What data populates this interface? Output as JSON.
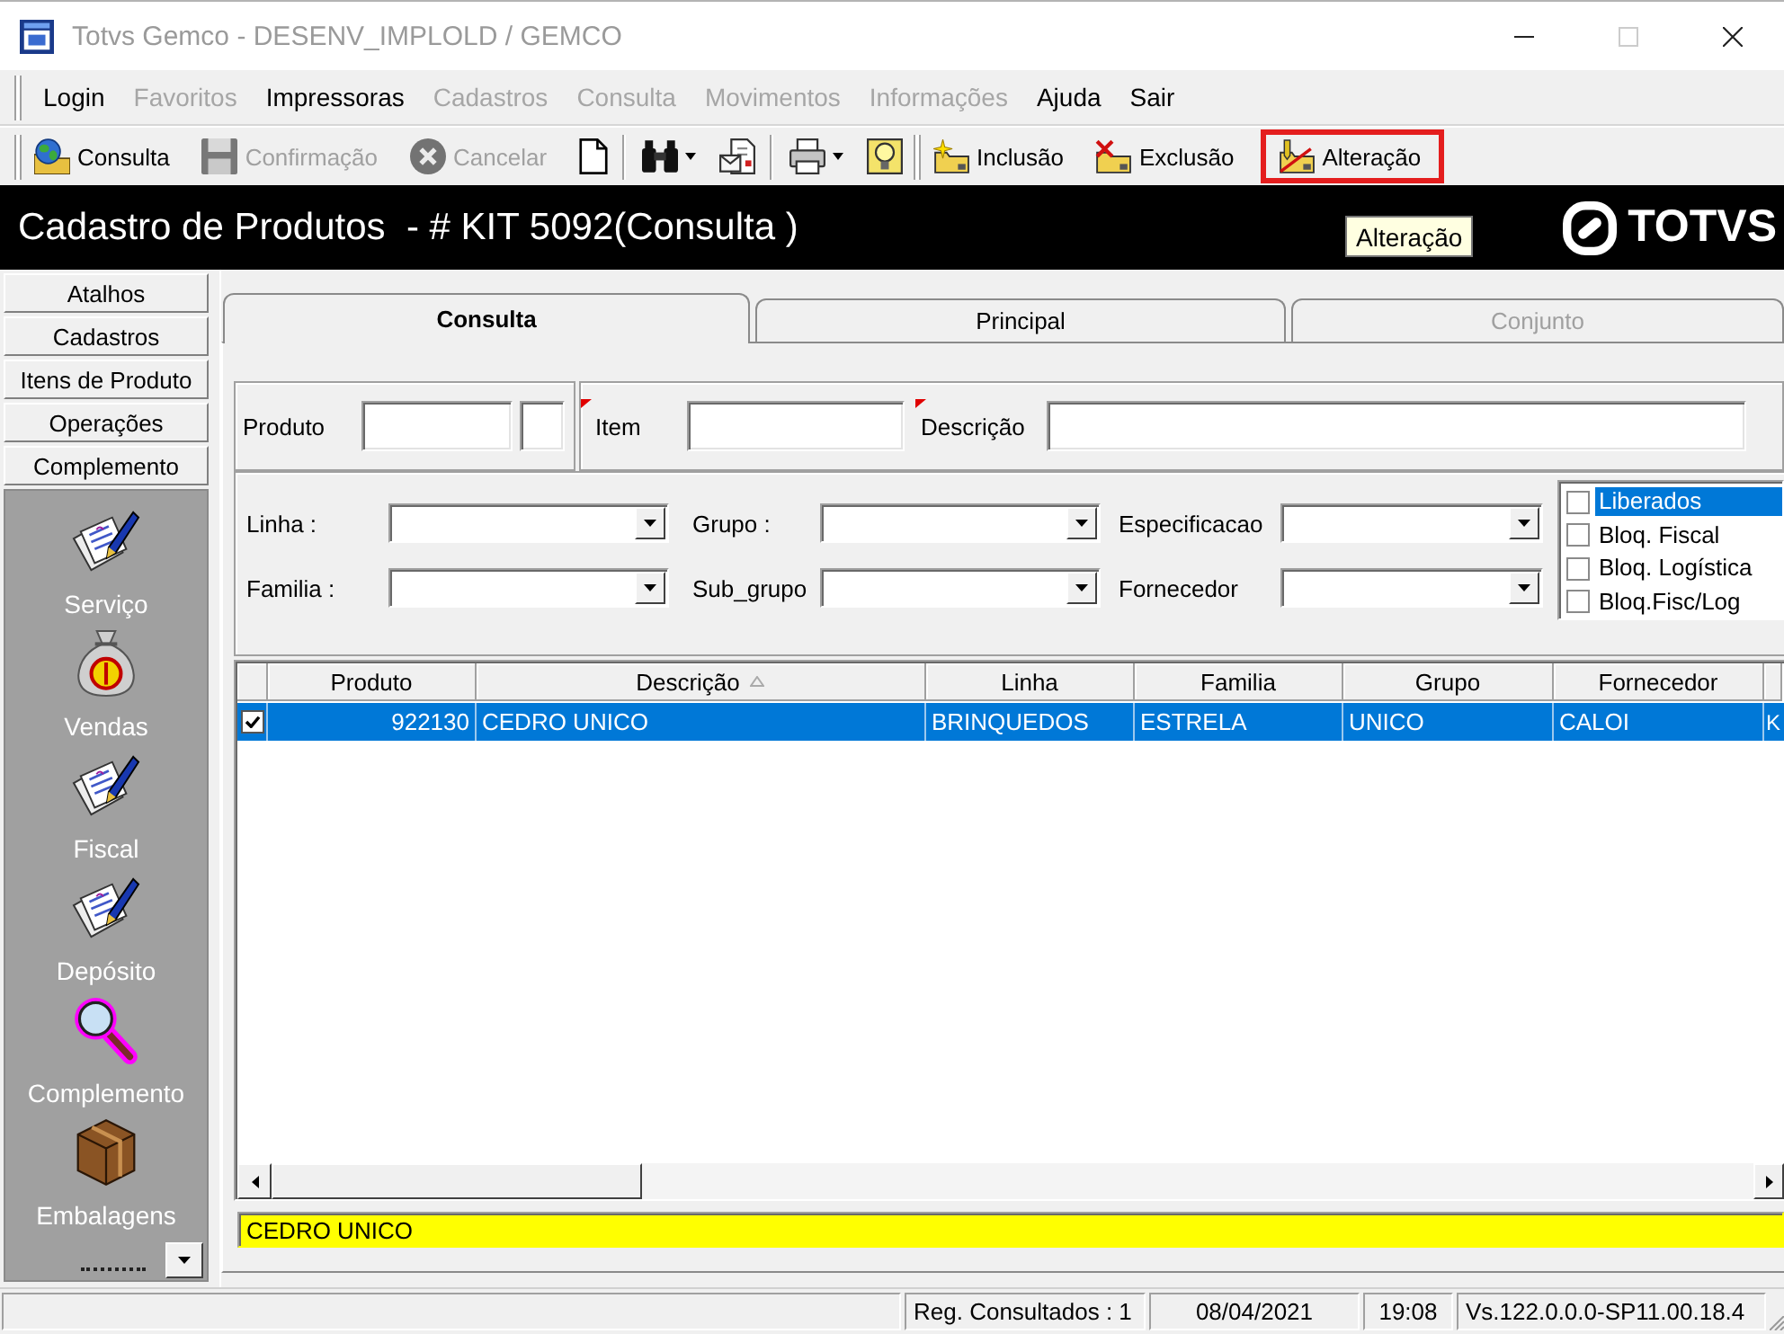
{
  "window": {
    "title": "Totvs Gemco - DESENV_IMPLOLD / GEMCO",
    "controls": [
      {
        "kind": "minimize",
        "disabled": false
      },
      {
        "kind": "maximize",
        "disabled": true
      },
      {
        "kind": "close",
        "disabled": false
      }
    ]
  },
  "menu": [
    {
      "label": "Login",
      "disabled": false
    },
    {
      "label": "Favoritos",
      "disabled": true
    },
    {
      "label": "Impressoras",
      "disabled": false
    },
    {
      "label": "Cadastros",
      "disabled": true
    },
    {
      "label": "Consulta",
      "disabled": true
    },
    {
      "label": "Movimentos",
      "disabled": true
    },
    {
      "label": "Informações",
      "disabled": true
    },
    {
      "label": "Ajuda",
      "disabled": false
    },
    {
      "label": "Sair",
      "disabled": false
    }
  ],
  "toolbars": [
    {
      "groups": [
        [
          {
            "kind": "text",
            "label": "Consulta",
            "disabled": false,
            "highlighted": false
          },
          {
            "kind": "text",
            "label": "Confirmação",
            "disabled": true,
            "highlighted": false
          },
          {
            "kind": "text",
            "label": "Cancelar",
            "disabled": true,
            "highlighted": false
          },
          {
            "kind": "icon",
            "disabled": false,
            "highlighted": false
          }
        ],
        [
          {
            "kind": "dropdown",
            "disabled": false,
            "highlighted": false
          },
          {
            "kind": "icon",
            "disabled": false,
            "highlighted": false
          }
        ],
        [
          {
            "kind": "dropdown",
            "disabled": false,
            "highlighted": false
          },
          {
            "kind": "icon",
            "disabled": false,
            "highlighted": false
          }
        ]
      ]
    },
    {
      "groups": [
        [
          {
            "kind": "text",
            "label": "Inclusão",
            "disabled": false,
            "highlighted": false
          },
          {
            "kind": "text",
            "label": "Exclusão",
            "disabled": false,
            "highlighted": false
          },
          {
            "kind": "text",
            "label": "Alteração",
            "disabled": false,
            "highlighted": true
          }
        ]
      ]
    }
  ],
  "header": {
    "title": "Cadastro de Produtos  - # KIT 5092(Consulta )",
    "logo_text": "TOTVS"
  },
  "tooltip": {
    "text": "Alteração"
  },
  "sidebar": {
    "sections": [
      {
        "label": "Atalhos"
      },
      {
        "label": "Cadastros"
      },
      {
        "label": "Itens de Produto"
      },
      {
        "label": "Operações"
      },
      {
        "label": "Complemento",
        "items": [
          {
            "label": "Serviço"
          },
          {
            "label": "Vendas"
          },
          {
            "label": "Fiscal"
          },
          {
            "label": "Depósito"
          },
          {
            "label": "Complemento"
          },
          {
            "label": "Embalagens"
          }
        ]
      }
    ]
  },
  "tabs": [
    {
      "label": "Consulta",
      "selected": true,
      "disabled": false
    },
    {
      "label": "Principal",
      "selected": false,
      "disabled": false
    },
    {
      "label": "Conjunto",
      "selected": false,
      "disabled": true
    }
  ],
  "search_fields": [
    {
      "kind": "split",
      "label": "Produto",
      "marked": false
    },
    {
      "kind": "text",
      "label": "Item",
      "marked": true
    },
    {
      "kind": "text",
      "label": "Descrição",
      "marked": true
    }
  ],
  "filters": [
    {
      "label": "Linha :"
    },
    {
      "label": "Grupo :"
    },
    {
      "label": "Especificacao"
    },
    {
      "label": "Familia :"
    },
    {
      "label": "Sub_grupo"
    },
    {
      "label": "Fornecedor"
    }
  ],
  "status_filters": [
    {
      "label": "Liberados",
      "checked": false,
      "selected": true
    },
    {
      "label": "Bloq. Fiscal",
      "checked": false,
      "selected": false
    },
    {
      "label": "Bloq. Logística",
      "checked": false,
      "selected": false
    },
    {
      "label": "Bloq.Fisc/Log",
      "checked": false,
      "selected": false
    }
  ],
  "table": {
    "columns": [
      {
        "label": "Produto",
        "kind": "number",
        "sorted": false
      },
      {
        "label": "Descrição",
        "kind": "text",
        "sorted": true
      },
      {
        "label": "Linha",
        "kind": "text",
        "sorted": false
      },
      {
        "label": "Familia",
        "kind": "text",
        "sorted": false
      },
      {
        "label": "Grupo",
        "kind": "text",
        "sorted": false
      },
      {
        "label": "Fornecedor",
        "kind": "text",
        "sorted": false
      },
      {
        "kind": "text",
        "sorted": false
      }
    ],
    "rows": [
      {
        "selected": true,
        "checked": true,
        "cells": [
          "922130",
          "CEDRO UNICO",
          "BRINQUEDOS",
          "ESTRELA",
          "UNICO",
          "CALOI",
          "K"
        ]
      }
    ]
  },
  "summary": {
    "value": "CEDRO UNICO"
  },
  "status_bar": {
    "records": "Reg. Consultados : 1",
    "date": "08/04/2021",
    "time": "19:08",
    "version": "Vs.122.0.0.0-SP11.00.18.4"
  }
}
